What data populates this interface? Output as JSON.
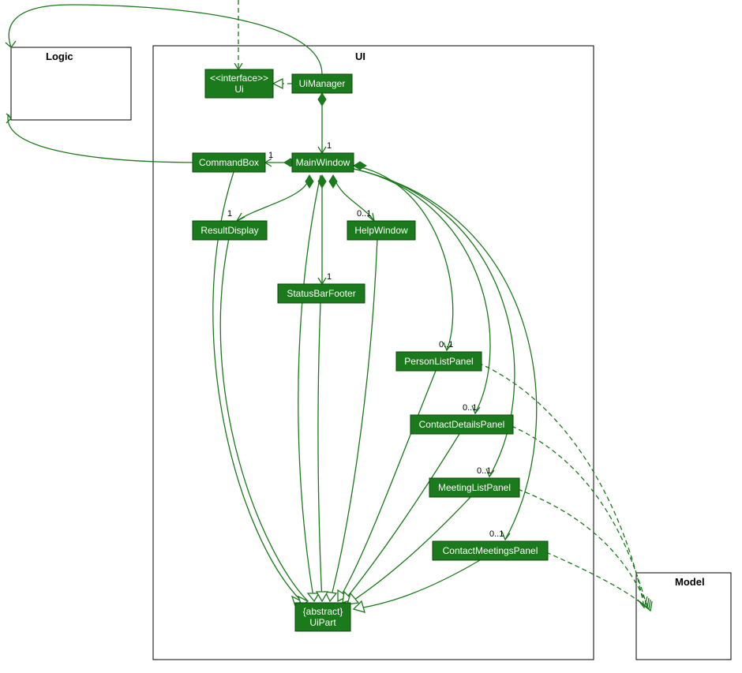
{
  "packages": {
    "logic": {
      "label": "Logic"
    },
    "ui": {
      "label": "UI"
    },
    "model": {
      "label": "Model"
    }
  },
  "nodes": {
    "uiInterface": {
      "stereotype": "<<interface>>",
      "name": "Ui"
    },
    "uiManager": {
      "name": "UiManager"
    },
    "commandBox": {
      "name": "CommandBox"
    },
    "mainWindow": {
      "name": "MainWindow"
    },
    "resultDisplay": {
      "name": "ResultDisplay"
    },
    "helpWindow": {
      "name": "HelpWindow"
    },
    "statusBar": {
      "name": "StatusBarFooter"
    },
    "personList": {
      "name": "PersonListPanel"
    },
    "contactDetails": {
      "name": "ContactDetailsPanel"
    },
    "meetingList": {
      "name": "MeetingListPanel"
    },
    "contactMeetings": {
      "name": "ContactMeetingsPanel"
    },
    "uiPart": {
      "stereotype": "{abstract}",
      "name": "UiPart"
    }
  },
  "multiplicities": {
    "mainWindow": "1",
    "commandBox": "1",
    "resultDisplay": "1",
    "helpWindow": "0..1",
    "statusBar": "1",
    "personList": "0..1",
    "contactDetails": "0..1",
    "meetingList": "0..1",
    "contactMeetings": "0..1"
  },
  "colors": {
    "node": "#1b7a1b",
    "edge": "#1b7a1b"
  }
}
